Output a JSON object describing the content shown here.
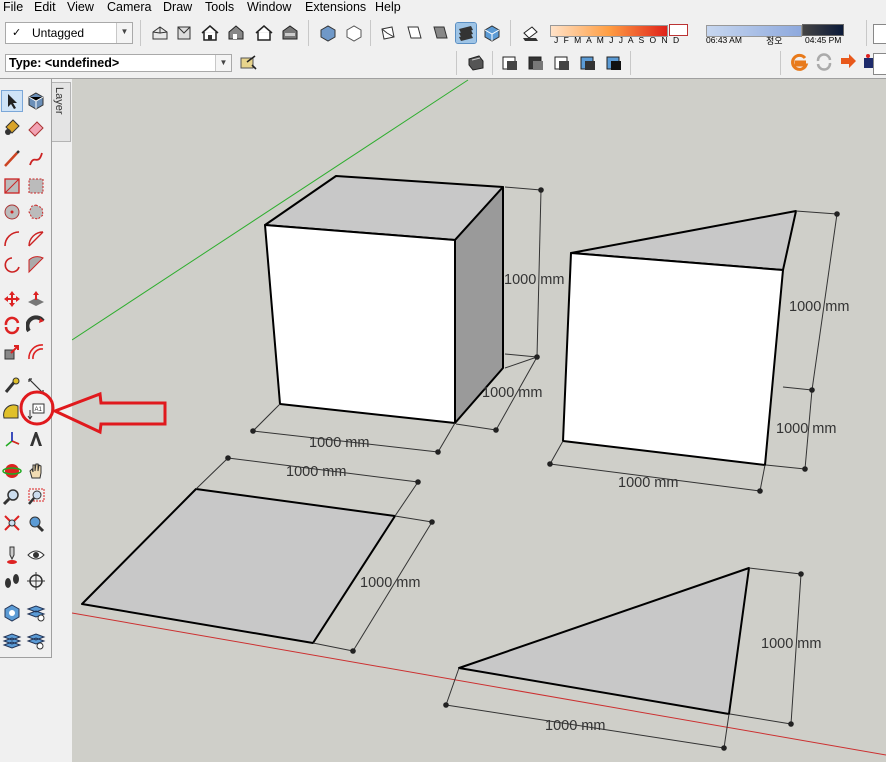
{
  "menu": [
    "File",
    "Edit",
    "View",
    "Camera",
    "Draw",
    "Tools",
    "Window",
    "Extensions",
    "Help"
  ],
  "tag_selector": {
    "check": "✓",
    "value": "Untagged"
  },
  "type_selector": {
    "value": "Type: <undefined>"
  },
  "shadow_months": "J F M A M J J A S O N D",
  "shadow_time_start": "06:43 AM",
  "shadow_time_noon": "정오",
  "shadow_time_end": "04:45 PM",
  "layer_tab": "Layer",
  "dimensions": {
    "cube_height": "1000 mm",
    "cube_depth": "1000 mm",
    "cube_width": "1000 mm",
    "prism_top_depth": "1000 mm",
    "prism_height": "1000 mm",
    "prism_width": "1000 mm",
    "square_top": "1000 mm",
    "square_right": "1000 mm",
    "triangle_right": "1000 mm",
    "triangle_bottom": "1000 mm"
  },
  "colors": {
    "canvas": "#cfcfc9",
    "face_front": "#ffffff",
    "face_gray": "#c8c8c8",
    "face_side": "#9a9a9a",
    "green_axis": "#2fae2f",
    "red_axis": "#cc3030",
    "annotation_red": "#e0191d"
  }
}
